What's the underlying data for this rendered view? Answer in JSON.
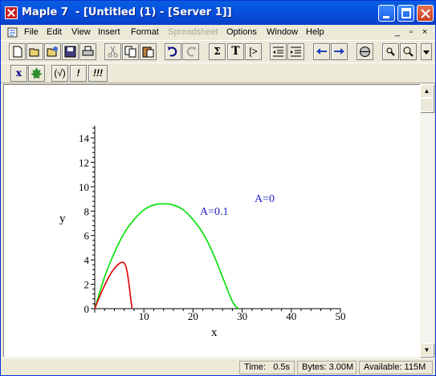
{
  "window": {
    "title": "Maple 7  - [Untitled (1) - [Server 1]]",
    "icon": "maple-app-icon"
  },
  "title_buttons": [
    "minimize-icon",
    "maximize-icon",
    "close-icon"
  ],
  "menubar": {
    "items": [
      {
        "label": "File",
        "enabled": true
      },
      {
        "label": "Edit",
        "enabled": true
      },
      {
        "label": "View",
        "enabled": true
      },
      {
        "label": "Insert",
        "enabled": true
      },
      {
        "label": "Format",
        "enabled": true
      },
      {
        "label": "Spreadsheet",
        "enabled": false
      },
      {
        "label": "Options",
        "enabled": true
      },
      {
        "label": "Window",
        "enabled": true
      },
      {
        "label": "Help",
        "enabled": true
      }
    ],
    "mdi_controls": [
      "_",
      "▫",
      "×"
    ]
  },
  "toolbar1": [
    "new-document-icon",
    "open-icon",
    "open-url-icon",
    "save-icon",
    "print-icon",
    "cut-icon",
    "copy-icon",
    "paste-icon",
    "undo-icon",
    "redo-icon",
    "sum-icon",
    "text-icon",
    "prompt-icon",
    "outdent-icon",
    "indent-icon",
    "back-icon",
    "forward-icon",
    "stop-icon",
    "zoom-in-icon",
    "zoom-out-icon"
  ],
  "toolbar1_labels": {
    "sum": "Σ",
    "text": "T",
    "prompt": "[>"
  },
  "toolbar2": {
    "x_label": "x",
    "buttons": [
      "(√)",
      "!",
      "!!!"
    ]
  },
  "plot": {
    "annotations": [
      {
        "text": "A=0.1",
        "color": "#2020c0"
      },
      {
        "text": "A=0",
        "color": "#2020c0"
      }
    ]
  },
  "chart_data": {
    "type": "line",
    "title": "",
    "xlabel": "x",
    "ylabel": "y",
    "xlim": [
      0,
      50
    ],
    "ylim": [
      0,
      15
    ],
    "xticks": [
      "10",
      "20",
      "30",
      "40",
      "50"
    ],
    "yticks": [
      "0",
      "2",
      "4",
      "6",
      "8",
      "10",
      "12",
      "14"
    ],
    "grid": false,
    "series": [
      {
        "color": "#00e000",
        "x": [
          0,
          2,
          4,
          6,
          8,
          10,
          12,
          14,
          16,
          18,
          20,
          22,
          24,
          26,
          28,
          29.2
        ],
        "y": [
          0,
          2.6,
          4.6,
          6.2,
          7.3,
          8.1,
          8.5,
          8.6,
          8.5,
          8.1,
          7.3,
          6.2,
          4.6,
          2.6,
          0.6,
          0
        ]
      },
      {
        "color": "#e00000",
        "x": [
          0,
          1,
          2,
          3,
          4,
          5,
          5.7,
          6.2,
          6.6,
          7.0,
          7.3,
          7.6
        ],
        "y": [
          0,
          1.0,
          1.9,
          2.7,
          3.3,
          3.7,
          3.8,
          3.6,
          3.0,
          1.9,
          0.9,
          0
        ]
      }
    ]
  },
  "statusbar": {
    "time": "Time:   0.5s",
    "bytes": "Bytes: 3.00M",
    "available": "Available: 115M"
  }
}
